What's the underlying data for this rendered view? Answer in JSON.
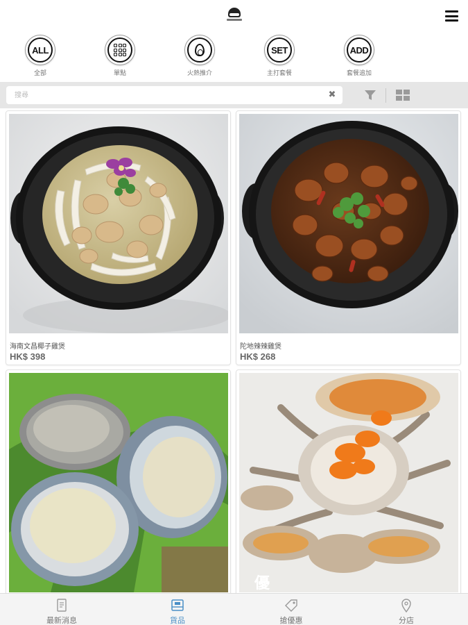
{
  "header": {
    "logo_icon": "restaurant-logo-icon",
    "menu_icon": "hamburger-menu-icon"
  },
  "categories": [
    {
      "id": "all",
      "badge": "ALL",
      "label": "全部"
    },
    {
      "id": "single",
      "badge": "",
      "label": "單點",
      "icon": "grid-icon"
    },
    {
      "id": "hot",
      "badge": "",
      "label": "火熱推介",
      "icon": "flame-icon"
    },
    {
      "id": "set",
      "badge": "SET",
      "label": "主打套餐"
    },
    {
      "id": "add",
      "badge": "ADD",
      "label": "套餐追加"
    }
  ],
  "search": {
    "placeholder": "搜尋",
    "value": "",
    "clear_glyph": "✖",
    "filter_icon": "filter-icon",
    "view_icon": "grid-view-icon"
  },
  "products": [
    {
      "name": "海南文昌椰子雞煲",
      "price": "HK$ 398",
      "image": "coconut-chicken-clay-pot"
    },
    {
      "name": "陀地辣辣雞煲",
      "price": "HK$ 268",
      "image": "spicy-chicken-clay-pot"
    },
    {
      "name": "",
      "price": "",
      "image": "abalone-on-lettuce"
    },
    {
      "name": "",
      "price": "",
      "image": "crab-with-roe",
      "watermark": "優"
    }
  ],
  "bottom_nav": [
    {
      "label": "最新消息",
      "icon": "news-icon",
      "active": false
    },
    {
      "label": "貨品",
      "icon": "products-icon",
      "active": true
    },
    {
      "label": "搶優惠",
      "icon": "tag-icon",
      "active": false
    },
    {
      "label": "分店",
      "icon": "location-pin-icon",
      "active": false
    }
  ],
  "colors": {
    "accent": "#4a8fc6",
    "searchbar_bg": "#e6e6e6",
    "nav_bg": "#f4f4f4"
  }
}
